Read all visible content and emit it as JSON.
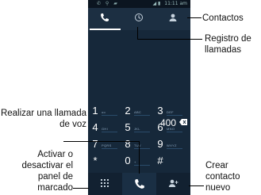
{
  "phone": {
    "status_time": "11:11",
    "status_ampm": "am",
    "dialed_number": "400",
    "keys": [
      {
        "digit": "1",
        "letters": "oo"
      },
      {
        "digit": "2",
        "letters": "ABC"
      },
      {
        "digit": "3",
        "letters": "DEF"
      },
      {
        "digit": "4",
        "letters": "GHI"
      },
      {
        "digit": "5",
        "letters": "JKL"
      },
      {
        "digit": "6",
        "letters": "MNO"
      },
      {
        "digit": "7",
        "letters": "PQRS"
      },
      {
        "digit": "8",
        "letters": "TUV"
      },
      {
        "digit": "9",
        "letters": "WXYZ"
      },
      {
        "digit": "*",
        "letters": ""
      },
      {
        "digit": "0",
        "letters": "+"
      },
      {
        "digit": "#",
        "letters": ""
      }
    ]
  },
  "annotations": {
    "contacts": "Contactos",
    "call_log": "Registro de llamadas",
    "voice_call": "Realizar una llamada de voz",
    "toggle_pad": "Activar o desactivar el panel de marcado",
    "new_contact": "Crear contacto nuevo"
  },
  "colors": {
    "screen_bg": "#16283a",
    "tab_bg": "#1c2f42",
    "accent_line": "#2a4c6a"
  },
  "icons": {
    "phone_tab": "phone-icon",
    "history_tab": "clock-icon",
    "contacts_tab": "person-icon",
    "backspace": "backspace-icon",
    "dialpad": "dialpad-icon",
    "call": "call-icon",
    "add_contact": "add-contact-icon"
  }
}
